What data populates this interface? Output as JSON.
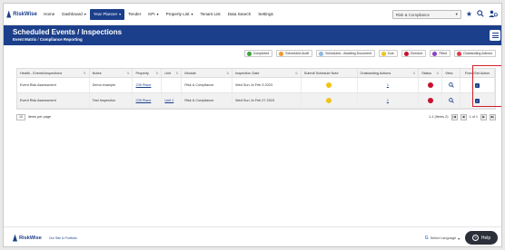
{
  "app": {
    "logo_text": "RiskWise"
  },
  "nav": {
    "items": [
      {
        "label": "Home"
      },
      {
        "label": "Dashboard",
        "caret": "▾"
      },
      {
        "label": "Year Planner",
        "caret": "▾",
        "active": true
      },
      {
        "label": "Tender"
      },
      {
        "label": "KPI",
        "caret": "▾"
      },
      {
        "label": "Property List",
        "caret": "▾"
      },
      {
        "label": "Tenant List"
      },
      {
        "label": "Data Search"
      },
      {
        "label": "Settings"
      }
    ],
    "module_select": "Risk & Compliance"
  },
  "header": {
    "title": "Scheduled Events / Inspections",
    "crumb_1": "Event Matrix",
    "crumb_sep": "/",
    "crumb_2": "Compliance Reporting"
  },
  "legend": [
    {
      "label": "Completed",
      "color": "#3aa63a"
    },
    {
      "label": "Scheduled Audit",
      "color": "#f09a2a"
    },
    {
      "label": "Scheduled - Awaiting Document",
      "color": "#8fb8e0"
    },
    {
      "label": "Due",
      "color": "#f0c419"
    },
    {
      "label": "Overdue",
      "color": "#c8102e"
    },
    {
      "label": "Filled",
      "color": "#8b3fc1"
    },
    {
      "label": "Outstanding Actions",
      "color": "#e23b4a"
    }
  ],
  "table": {
    "columns": [
      {
        "label": "Health - Events/Inspections"
      },
      {
        "label": "Notes"
      },
      {
        "label": "Property"
      },
      {
        "label": "Unit"
      },
      {
        "label": "Module"
      },
      {
        "label": "Inspection Date"
      },
      {
        "label": "Submit Schedule Note"
      },
      {
        "label": "Outstanding Actions"
      },
      {
        "label": "Status"
      },
      {
        "label": "View"
      },
      {
        "label": "Fixed/Set Action"
      }
    ],
    "sort_glyph": "⇅",
    "rows": [
      {
        "event": "Event Risk Assessment",
        "notes": "Demo example",
        "property": "239 Place",
        "unit": "",
        "module": "Risk & Compliance",
        "date": "Wed Sun Jn Feb 3 2023",
        "outstanding": "1"
      },
      {
        "event": "Event Risk Assessment",
        "notes": "Test Inspection",
        "property": "239 Place",
        "unit": "Unit 1",
        "module": "Risk & Compliance",
        "date": "Wed Sun Jn Feb 27 2023",
        "outstanding": "1"
      }
    ]
  },
  "pager": {
    "per_page": "10",
    "per_page_label": "items per page",
    "range": "1-1 (Items 2)",
    "page_of": "1 of 1"
  },
  "footer": {
    "logo_text": "RiskWise",
    "link_text": "Our Site & Portfolio",
    "translate_label": "Select Language",
    "help_label": "Help"
  }
}
